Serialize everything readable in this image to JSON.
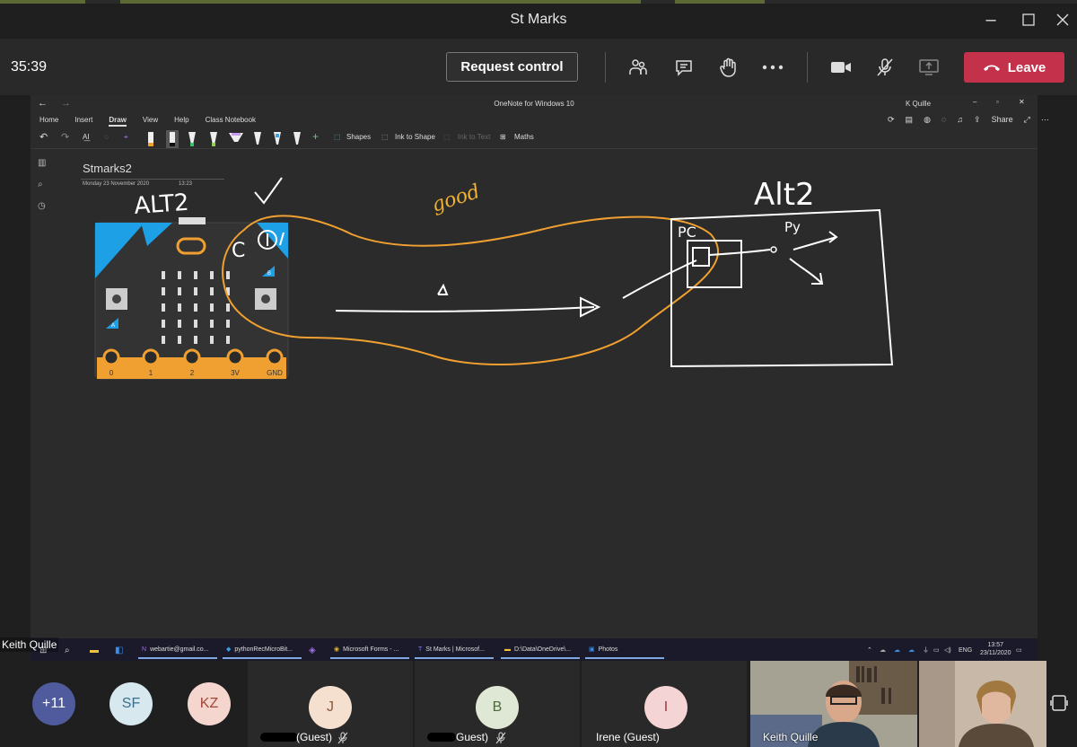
{
  "window": {
    "title": "St Marks"
  },
  "meeting": {
    "timer": "35:39",
    "request_control": "Request control",
    "leave": "Leave",
    "colors": {
      "leave": "#c4314b",
      "bar": "#292929"
    }
  },
  "onenote": {
    "window_title": "OneNote for Windows 10",
    "user": "K Quille",
    "share": "Share",
    "menu": [
      "Home",
      "Insert",
      "Draw",
      "View",
      "Help",
      "Class Notebook"
    ],
    "selected_menu": "Draw",
    "ribbon": {
      "shapes": "Shapes",
      "ink_to_shape": "Ink to Shape",
      "ink_to_text": "Ink to Text",
      "maths": "Maths"
    },
    "page": {
      "title": "Stmarks2",
      "date": "Monday 23 November 2020",
      "time": "13:23"
    },
    "microbit": {
      "pins": [
        "0",
        "1",
        "2",
        "3V",
        "GND"
      ],
      "button_a": "A",
      "button_b": "B"
    },
    "ink": {
      "alt_left": "ALT2",
      "alt_right": "Alt2",
      "good": "good",
      "pc": "PC",
      "py": "Py",
      "circle_label": "C"
    }
  },
  "taskbar": {
    "apps": [
      "webartie@gmail.co...",
      "pythonRecMicroBit...",
      "Microsoft Forms - ...",
      "St Marks | Microsof...",
      "D:\\Data\\OneDrive\\...",
      "Photos"
    ],
    "lang": "ENG",
    "time": "13:57",
    "date": "23/11/2020"
  },
  "presenter": "Keith Quille",
  "participants": [
    {
      "initials": "+11",
      "color": "#4f5b9c",
      "text": "#ffffff"
    },
    {
      "initials": "SF",
      "color": "#d8e8ef",
      "text": "#3a6e8a"
    },
    {
      "initials": "KZ",
      "color": "#f4d6cf",
      "text": "#a0473a"
    },
    {
      "initials": "J",
      "color": "#f5dfcf",
      "text": "#8a5a3a",
      "name": "(Guest)"
    },
    {
      "initials": "B",
      "color": "#dfe8d5",
      "text": "#4e6a3a",
      "name": "Guest)"
    },
    {
      "initials": "I",
      "color": "#f4d4d4",
      "text": "#9a3a3a",
      "name": "Irene (Guest)"
    }
  ],
  "video_names": [
    "Keith Quille"
  ]
}
